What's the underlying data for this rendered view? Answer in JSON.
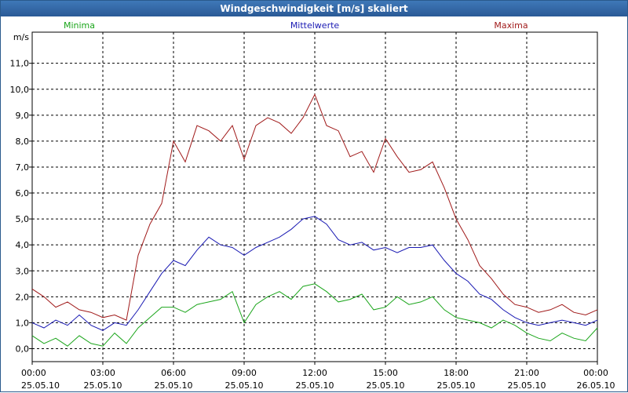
{
  "window": {
    "title": "Windgeschwindigkeit [m/s] skaliert"
  },
  "chart_data": {
    "type": "line",
    "ylabel": "m/s",
    "ylim": [
      -0.5,
      12.2
    ],
    "yticks": [
      0,
      1,
      2,
      3,
      4,
      5,
      6,
      7,
      8,
      9,
      10,
      11
    ],
    "ytick_labels": [
      "0,0",
      "1,0",
      "2,0",
      "3,0",
      "4,0",
      "5,0",
      "6,0",
      "7,0",
      "8,0",
      "9,0",
      "10,0",
      "11,0"
    ],
    "xlim": [
      0,
      24
    ],
    "xticks": [
      0,
      3,
      6,
      9,
      12,
      15,
      18,
      21,
      24
    ],
    "xtick_labels": [
      {
        "time": "00:00",
        "date": "25.05.10"
      },
      {
        "time": "03:00",
        "date": "25.05.10"
      },
      {
        "time": "06:00",
        "date": "25.05.10"
      },
      {
        "time": "09:00",
        "date": "25.05.10"
      },
      {
        "time": "12:00",
        "date": "25.05.10"
      },
      {
        "time": "15:00",
        "date": "25.05.10"
      },
      {
        "time": "18:00",
        "date": "25.05.10"
      },
      {
        "time": "21:00",
        "date": "25.05.10"
      },
      {
        "time": "00:00",
        "date": "26.05.10"
      }
    ],
    "grid": true,
    "legend_position": "top",
    "series": [
      {
        "name": "Minima",
        "color": "#1aa51a",
        "x": [
          0,
          0.5,
          1,
          1.5,
          2,
          2.5,
          3,
          3.5,
          4,
          4.5,
          5,
          5.5,
          6,
          6.5,
          7,
          7.5,
          8,
          8.5,
          9,
          9.5,
          10,
          10.5,
          11,
          11.5,
          12,
          12.5,
          13,
          13.5,
          14,
          14.5,
          15,
          15.5,
          16,
          16.5,
          17,
          17.5,
          18,
          18.5,
          19,
          19.5,
          20,
          20.5,
          21,
          21.5,
          22,
          22.5,
          23,
          23.5,
          24
        ],
        "y": [
          0.5,
          0.2,
          0.4,
          0.1,
          0.5,
          0.2,
          0.1,
          0.6,
          0.2,
          0.8,
          1.2,
          1.6,
          1.6,
          1.4,
          1.7,
          1.8,
          1.9,
          2.2,
          1.0,
          1.7,
          2.0,
          2.2,
          1.9,
          2.4,
          2.5,
          2.2,
          1.8,
          1.9,
          2.1,
          1.5,
          1.6,
          2.0,
          1.7,
          1.8,
          2.0,
          1.5,
          1.2,
          1.1,
          1.0,
          0.8,
          1.1,
          0.9,
          0.6,
          0.4,
          0.3,
          0.6,
          0.4,
          0.3,
          0.8
        ]
      },
      {
        "name": "Mittelwerte",
        "color": "#1a1ab3",
        "x": [
          0,
          0.5,
          1,
          1.5,
          2,
          2.5,
          3,
          3.5,
          4,
          4.5,
          5,
          5.5,
          6,
          6.5,
          7,
          7.5,
          8,
          8.5,
          9,
          9.5,
          10,
          10.5,
          11,
          11.5,
          12,
          12.5,
          13,
          13.5,
          14,
          14.5,
          15,
          15.5,
          16,
          16.5,
          17,
          17.5,
          18,
          18.5,
          19,
          19.5,
          20,
          20.5,
          21,
          21.5,
          22,
          22.5,
          23,
          23.5,
          24
        ],
        "y": [
          1.0,
          0.8,
          1.1,
          0.9,
          1.3,
          0.9,
          0.7,
          1.0,
          0.9,
          1.5,
          2.2,
          2.9,
          3.4,
          3.2,
          3.8,
          4.3,
          4.0,
          3.9,
          3.6,
          3.9,
          4.1,
          4.3,
          4.6,
          5.0,
          5.1,
          4.8,
          4.2,
          4.0,
          4.1,
          3.8,
          3.9,
          3.7,
          3.9,
          3.9,
          4.0,
          3.4,
          2.9,
          2.6,
          2.1,
          1.9,
          1.5,
          1.2,
          1.0,
          0.9,
          1.0,
          1.1,
          1.0,
          0.9,
          1.1
        ]
      },
      {
        "name": "Maxima",
        "color": "#a01a1a",
        "x": [
          0,
          0.5,
          1,
          1.5,
          2,
          2.5,
          3,
          3.5,
          4,
          4.5,
          5,
          5.5,
          6,
          6.5,
          7,
          7.5,
          8,
          8.5,
          9,
          9.5,
          10,
          10.5,
          11,
          11.5,
          12,
          12.5,
          13,
          13.5,
          14,
          14.5,
          15,
          15.5,
          16,
          16.5,
          17,
          17.5,
          18,
          18.5,
          19,
          19.5,
          20,
          20.5,
          21,
          21.5,
          22,
          22.5,
          23,
          23.5,
          24
        ],
        "y": [
          2.3,
          2.0,
          1.6,
          1.8,
          1.5,
          1.4,
          1.2,
          1.3,
          1.1,
          3.6,
          4.8,
          5.6,
          8.0,
          7.2,
          8.6,
          8.4,
          8.0,
          8.6,
          7.3,
          8.6,
          8.9,
          8.7,
          8.3,
          8.9,
          9.8,
          8.6,
          8.4,
          7.4,
          7.6,
          6.8,
          8.1,
          7.4,
          6.8,
          6.9,
          7.2,
          6.2,
          5.0,
          4.2,
          3.2,
          2.7,
          2.1,
          1.7,
          1.6,
          1.4,
          1.5,
          1.7,
          1.4,
          1.3,
          1.5
        ]
      }
    ]
  }
}
